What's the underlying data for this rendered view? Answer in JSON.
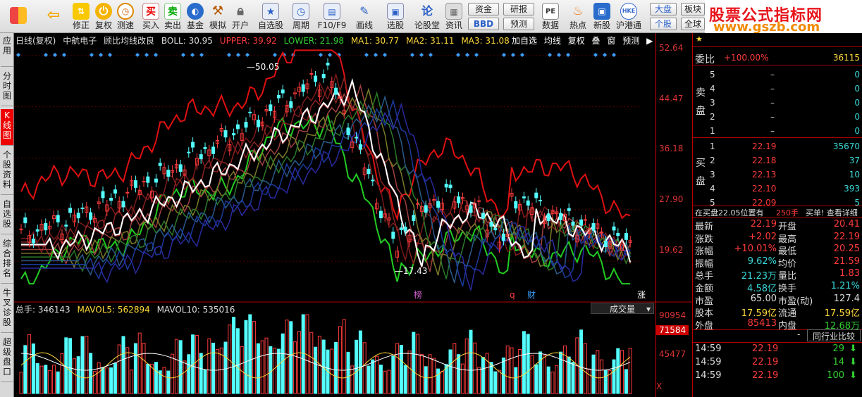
{
  "toolbar": {
    "buttons": [
      {
        "label": "",
        "icon": "app-grid-icon"
      },
      {
        "label": "",
        "icon": "back-arrow-icon"
      },
      {
        "label": "修正",
        "icon": "sort-icon"
      },
      {
        "label": "复权",
        "icon": "power-icon"
      },
      {
        "label": "测速",
        "icon": "clock-icon"
      },
      {
        "label": "买入",
        "icon": "buy-icon"
      },
      {
        "label": "卖出",
        "icon": "sell-icon"
      },
      {
        "label": "基金",
        "icon": "fund-icon"
      },
      {
        "label": "模拟",
        "icon": "hammer-icon"
      },
      {
        "label": "开户",
        "icon": "lock-icon"
      },
      {
        "label": "自选股",
        "icon": "star-icon"
      },
      {
        "label": "周期",
        "icon": "period-icon"
      },
      {
        "label": "F10/F9",
        "icon": "f10-icon"
      },
      {
        "label": "画线",
        "icon": "pen-icon"
      },
      {
        "label": "选股",
        "icon": "select-icon"
      },
      {
        "label": "论股堂",
        "icon": "forum-icon"
      },
      {
        "label": "资讯",
        "icon": "news-icon"
      },
      {
        "label": "数据",
        "icon": "pe-icon"
      },
      {
        "label": "热点",
        "icon": "hot-icon"
      },
      {
        "label": "新股",
        "icon": "ipo-icon"
      },
      {
        "label": "沪港通",
        "icon": "hk-icon"
      }
    ],
    "small_buttons": {
      "zijin": "资金",
      "bbd": "BBD",
      "yanbao": "研报",
      "yuce": "预测",
      "dapan": "大盘",
      "gegu": "个股",
      "bankuai": "板块",
      "quanqiu": "全球"
    },
    "watermark": {
      "title": "股票公式指标网",
      "url": "www.gszb.com"
    }
  },
  "sidebar": {
    "tabs": [
      "应用",
      "分时图",
      "K线图",
      "个股资料",
      "自选股",
      "综合排名",
      "牛叉诊股",
      "超级盘口"
    ],
    "active_index": 2
  },
  "chart": {
    "info": {
      "period": "日线(复权)",
      "stock": "中航电子",
      "indicator": "顾比均线改良",
      "boll": "BOLL: 30.95",
      "upper": "UPPER: 39.92",
      "lower": "LOWER: 21.98",
      "ma1": "MA1: 30.77",
      "ma2": "MA2: 31.11",
      "ma3": "MA3: 31.08"
    },
    "tools": [
      "加自选",
      "均线",
      "复权",
      "叠",
      "窗",
      "预测"
    ],
    "price_labels": [
      "52.64",
      "44.47",
      "36.18",
      "27.90",
      "19.62"
    ],
    "high_marker": "50.05",
    "low_marker": "17.43",
    "event_labels": {
      "bang": "榜",
      "q": "q",
      "cai": "财",
      "zhang": "涨"
    },
    "volume": {
      "total": "总手: 346143",
      "mavol5": "MAVOL5: 562894",
      "mavol10": "MAVOL10: 535016",
      "selector": "成交量",
      "axis_labels": [
        "90954",
        "71584",
        "45477"
      ],
      "close_mark": "X"
    }
  },
  "quote": {
    "header_label": "委比",
    "header_pct": "+100.00%",
    "header_val": "36115",
    "sell_label": "卖盘",
    "buy_label": "买盘",
    "sell": [
      {
        "n": "5",
        "price": "–",
        "vol": "0"
      },
      {
        "n": "4",
        "price": "–",
        "vol": "0"
      },
      {
        "n": "3",
        "price": "–",
        "vol": "0"
      },
      {
        "n": "2",
        "price": "–",
        "vol": "0"
      },
      {
        "n": "1",
        "price": "–",
        "vol": "0"
      }
    ],
    "buy": [
      {
        "n": "1",
        "price": "22.19",
        "vol": "35670"
      },
      {
        "n": "2",
        "price": "22.18",
        "vol": "37"
      },
      {
        "n": "3",
        "price": "22.13",
        "vol": "10"
      },
      {
        "n": "4",
        "price": "22.10",
        "vol": "393"
      },
      {
        "n": "5",
        "price": "22.09",
        "vol": "5"
      }
    ],
    "notice": {
      "left": "在买盘22.05位置有",
      "mid": "250手",
      "right": "买单! 查看详细"
    },
    "stats": [
      {
        "k1": "最新",
        "v1": "22.19",
        "k2": "开盘",
        "v2": "20.41"
      },
      {
        "k1": "涨跌",
        "v1": "+2.02",
        "k2": "最高",
        "v2": "22.19"
      },
      {
        "k1": "涨幅",
        "v1": "+10.01%",
        "k2": "最低",
        "v2": "20.25"
      },
      {
        "k1": "振幅",
        "v1": "9.62%",
        "k2": "均价",
        "v2": "21.59"
      },
      {
        "k1": "总手",
        "v1": "21.23万",
        "k2": "量比",
        "v2": "1.83"
      },
      {
        "k1": "金额",
        "v1": "4.58亿",
        "k2": "换手",
        "v2": "1.21%"
      },
      {
        "k1": "市盈",
        "v1": "65.00",
        "k2": "市盈(动)",
        "v2": "127.4"
      },
      {
        "k1": "股本",
        "v1": "17.59亿",
        "k2": "流通",
        "v2": "17.59亿"
      },
      {
        "k1": "外盘",
        "v1": "85413",
        "k2": "内盘",
        "v2": "12.68万"
      }
    ],
    "tabs": {
      "dash": "-",
      "compare": "同行业比较"
    },
    "ticks": [
      {
        "time": "14:59",
        "price": "22.19",
        "vol": "29"
      },
      {
        "time": "14:59",
        "price": "22.19",
        "vol": "14"
      },
      {
        "time": "14:59",
        "price": "22.19",
        "vol": "100"
      }
    ]
  },
  "colors": {
    "up": "#ff3b3b",
    "down": "#31d131",
    "boll_upper": "#e01010",
    "boll_lower": "#22cc22",
    "volume_down": "#54ffff"
  }
}
